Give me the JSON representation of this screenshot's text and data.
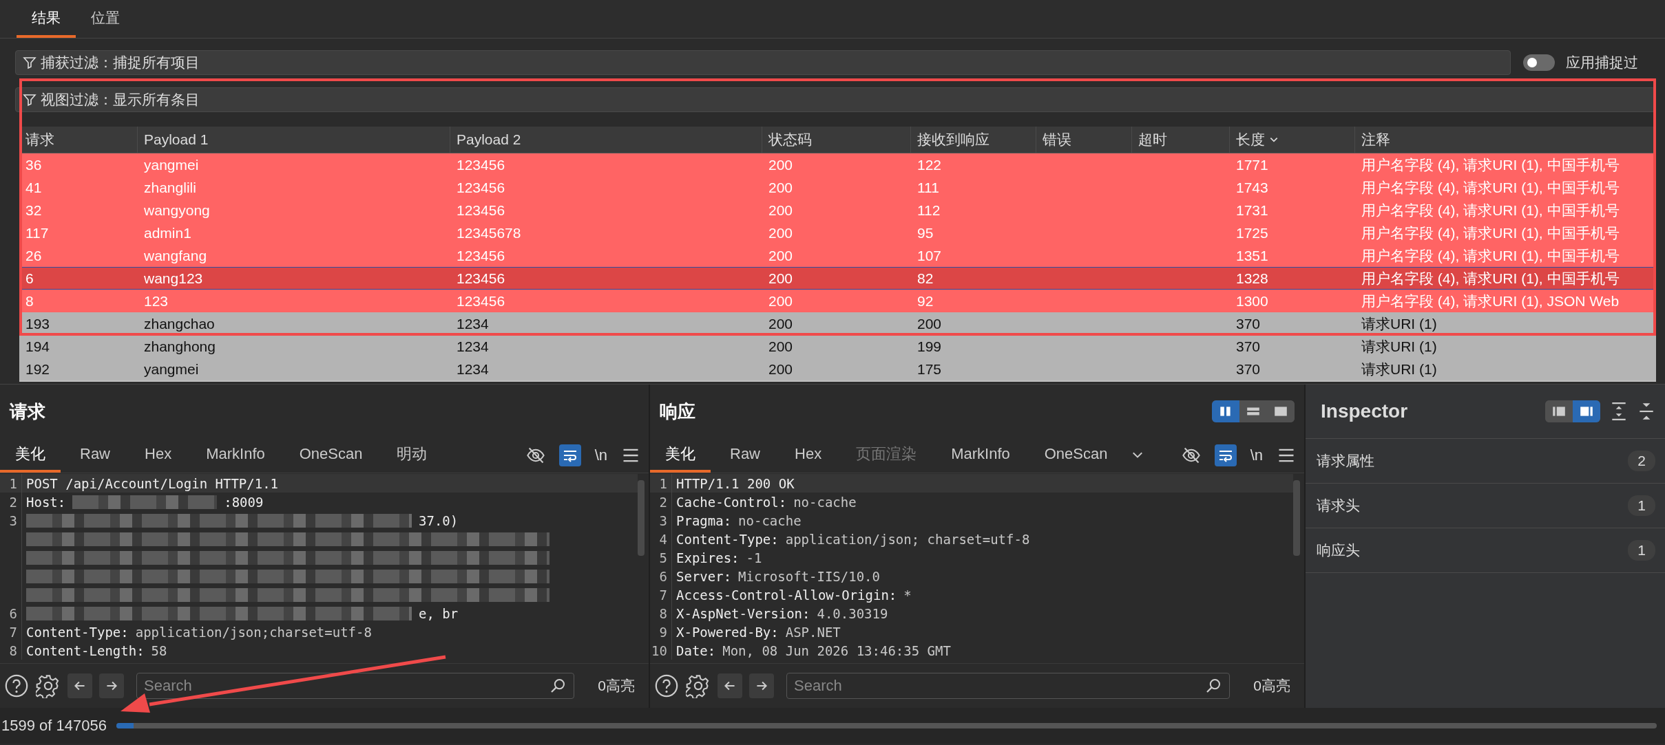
{
  "tabs": [
    {
      "label": "结果",
      "selected": true
    },
    {
      "label": "位置",
      "selected": false
    }
  ],
  "capture_filter": {
    "text": "捕获过滤：捕捉所有项目"
  },
  "apply_capture_filter": {
    "label": "应用捕捉过",
    "on": false
  },
  "view_filter": {
    "text": "视图过滤：显示所有条目"
  },
  "table": {
    "columns": [
      {
        "label": "请求",
        "sorted": false
      },
      {
        "label": "Payload 1",
        "sorted": false
      },
      {
        "label": "Payload 2",
        "sorted": false
      },
      {
        "label": "状态码",
        "sorted": false
      },
      {
        "label": "接收到响应",
        "sorted": false
      },
      {
        "label": "错误",
        "sorted": false
      },
      {
        "label": "超时",
        "sorted": false
      },
      {
        "label": "长度",
        "sorted": true
      },
      {
        "label": "注释",
        "sorted": false
      }
    ],
    "rows": [
      {
        "cells": [
          "36",
          "yangmei",
          "123456",
          "200",
          "122",
          "",
          "",
          "1771",
          "用户名字段 (4), 请求URI (1), 中国手机号"
        ],
        "color": "#ff6464",
        "selected": false
      },
      {
        "cells": [
          "41",
          "zhanglili",
          "123456",
          "200",
          "111",
          "",
          "",
          "1743",
          "用户名字段 (4), 请求URI (1), 中国手机号"
        ],
        "color": "#ff6464",
        "selected": false
      },
      {
        "cells": [
          "32",
          "wangyong",
          "123456",
          "200",
          "112",
          "",
          "",
          "1731",
          "用户名字段 (4), 请求URI (1), 中国手机号"
        ],
        "color": "#ff6464",
        "selected": false
      },
      {
        "cells": [
          "117",
          "admin1",
          "12345678",
          "200",
          "95",
          "",
          "",
          "1725",
          "用户名字段 (4), 请求URI (1), 中国手机号"
        ],
        "color": "#ff6464",
        "selected": false
      },
      {
        "cells": [
          "26",
          "wangfang",
          "123456",
          "200",
          "107",
          "",
          "",
          "1351",
          "用户名字段 (4), 请求URI (1), 中国手机号"
        ],
        "color": "#ff6464",
        "selected": false
      },
      {
        "cells": [
          "6",
          "wang123",
          "123456",
          "200",
          "82",
          "",
          "",
          "1328",
          "用户名字段 (4), 请求URI (1), 中国手机号"
        ],
        "color": "#dc4646",
        "selected": true
      },
      {
        "cells": [
          "8",
          "123",
          "123456",
          "200",
          "92",
          "",
          "",
          "1300",
          "用户名字段 (4), 请求URI (1), JSON Web"
        ],
        "color": "#ff6464",
        "selected": false
      },
      {
        "cells": [
          "193",
          "zhangchao",
          "1234",
          "200",
          "200",
          "",
          "",
          "370",
          "请求URI (1)"
        ],
        "color": "#b4b4b4",
        "selected": false
      },
      {
        "cells": [
          "194",
          "zhanghong",
          "1234",
          "200",
          "199",
          "",
          "",
          "370",
          "请求URI (1)"
        ],
        "color": "#b4b4b4",
        "selected": false
      },
      {
        "cells": [
          "192",
          "yangmei",
          "1234",
          "200",
          "175",
          "",
          "",
          "370",
          "请求URI (1)"
        ],
        "color": "#b4b4b4",
        "selected": false
      }
    ]
  },
  "panels": [
    {
      "title": "请求",
      "tabs": [
        {
          "label": "美化",
          "selected": true,
          "disabled": false
        },
        {
          "label": "Raw",
          "selected": false,
          "disabled": false
        },
        {
          "label": "Hex",
          "selected": false,
          "disabled": false
        },
        {
          "label": "MarkInfo",
          "selected": false,
          "disabled": false
        },
        {
          "label": "OneScan",
          "selected": false,
          "disabled": false
        },
        {
          "label": "明动",
          "selected": false,
          "disabled": false
        }
      ],
      "wrap_on": true,
      "newline_toggle": "\\n",
      "lines": [
        {
          "num": "1",
          "key": "POST /api/Account/Login HTTP/1.1",
          "current": true,
          "redacted": false
        },
        {
          "num": "2",
          "key": "Host:",
          "tail": ":8009",
          "current": false,
          "redacted": true
        },
        {
          "num": "3",
          "tail": "37.0)",
          "current": false,
          "redacted": true
        },
        {
          "current": false,
          "redacted": true
        },
        {
          "current": false,
          "redacted": true
        },
        {
          "current": false,
          "redacted": true
        },
        {
          "current": false,
          "redacted": true
        },
        {
          "num": "6",
          "tail": "e, br",
          "current": false,
          "redacted": true
        },
        {
          "num": "7",
          "key": "Content-Type:",
          "value": "application/json;charset=utf-8",
          "current": false,
          "redacted": false
        },
        {
          "num": "8",
          "key": "Content-Length:",
          "value": "58",
          "current": false,
          "redacted": false
        }
      ],
      "search": {
        "placeholder": "Search"
      },
      "highlights": "0高亮"
    },
    {
      "title": "响应",
      "layout_buttons": [
        {
          "kind": "columns",
          "selected": true
        },
        {
          "kind": "rows",
          "selected": false
        },
        {
          "kind": "single",
          "selected": false
        }
      ],
      "overflow_menu": true,
      "tabs": [
        {
          "label": "美化",
          "selected": true,
          "disabled": false
        },
        {
          "label": "Raw",
          "selected": false,
          "disabled": false
        },
        {
          "label": "Hex",
          "selected": false,
          "disabled": false
        },
        {
          "label": "页面渲染",
          "selected": false,
          "disabled": true
        },
        {
          "label": "MarkInfo",
          "selected": false,
          "disabled": false
        },
        {
          "label": "OneScan",
          "selected": false,
          "disabled": false
        }
      ],
      "wrap_on": true,
      "newline_toggle": "\\n",
      "lines": [
        {
          "num": "1",
          "key": "HTTP/1.1 200 OK",
          "current": true,
          "redacted": false
        },
        {
          "num": "2",
          "key": "Cache-Control:",
          "value": "no-cache",
          "current": false,
          "redacted": false
        },
        {
          "num": "3",
          "key": "Pragma:",
          "value": "no-cache",
          "current": false,
          "redacted": false
        },
        {
          "num": "4",
          "key": "Content-Type:",
          "value": "application/json; charset=utf-8",
          "current": false,
          "redacted": false
        },
        {
          "num": "5",
          "key": "Expires:",
          "value": "-1",
          "current": false,
          "redacted": false
        },
        {
          "num": "6",
          "key": "Server:",
          "value": "Microsoft-IIS/10.0",
          "current": false,
          "redacted": false
        },
        {
          "num": "7",
          "key": "Access-Control-Allow-Origin:",
          "value": "*",
          "current": false,
          "redacted": false
        },
        {
          "num": "8",
          "key": "X-AspNet-Version:",
          "value": "4.0.30319",
          "current": false,
          "redacted": false
        },
        {
          "num": "9",
          "key": "X-Powered-By:",
          "value": "ASP.NET",
          "current": false,
          "redacted": false
        },
        {
          "num": "10",
          "key": "Date:",
          "value": "Mon, 08 Jun 2026 13:46:35 GMT",
          "current": false,
          "redacted": false
        }
      ],
      "search": {
        "placeholder": "Search"
      },
      "highlights": "0高亮"
    }
  ],
  "inspector": {
    "title": "Inspector",
    "view_buttons": [
      {
        "kind": "left",
        "selected": false
      },
      {
        "kind": "right",
        "selected": true
      }
    ],
    "sections": [
      {
        "label": "请求属性",
        "count": "2"
      },
      {
        "label": "请求头",
        "count": "1"
      },
      {
        "label": "响应头",
        "count": "1"
      }
    ]
  },
  "status_bar": {
    "count": "1599 of 147056",
    "progress": {
      "level": 0.011
    }
  }
}
